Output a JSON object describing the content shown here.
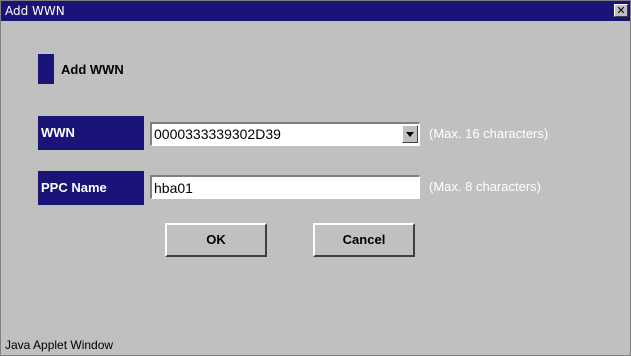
{
  "window": {
    "title": "Add WWN",
    "close_glyph": "✕"
  },
  "section": {
    "heading": "Add WWN"
  },
  "form": {
    "wwn": {
      "label": "WWN",
      "value": "0000333339302D39",
      "hint": "(Max. 16 characters)"
    },
    "ppc_name": {
      "label": "PPC Name",
      "value": "hba01",
      "hint": "(Max. 8 characters)"
    }
  },
  "buttons": {
    "ok": "OK",
    "cancel": "Cancel"
  },
  "status_bar": {
    "text": "Java Applet Window"
  },
  "colors": {
    "accent": "#1b1478",
    "background": "#c0c0c0",
    "hint_text": "#ffffff"
  },
  "icons": {
    "close": "close-icon",
    "dropdown": "chevron-down-icon"
  }
}
